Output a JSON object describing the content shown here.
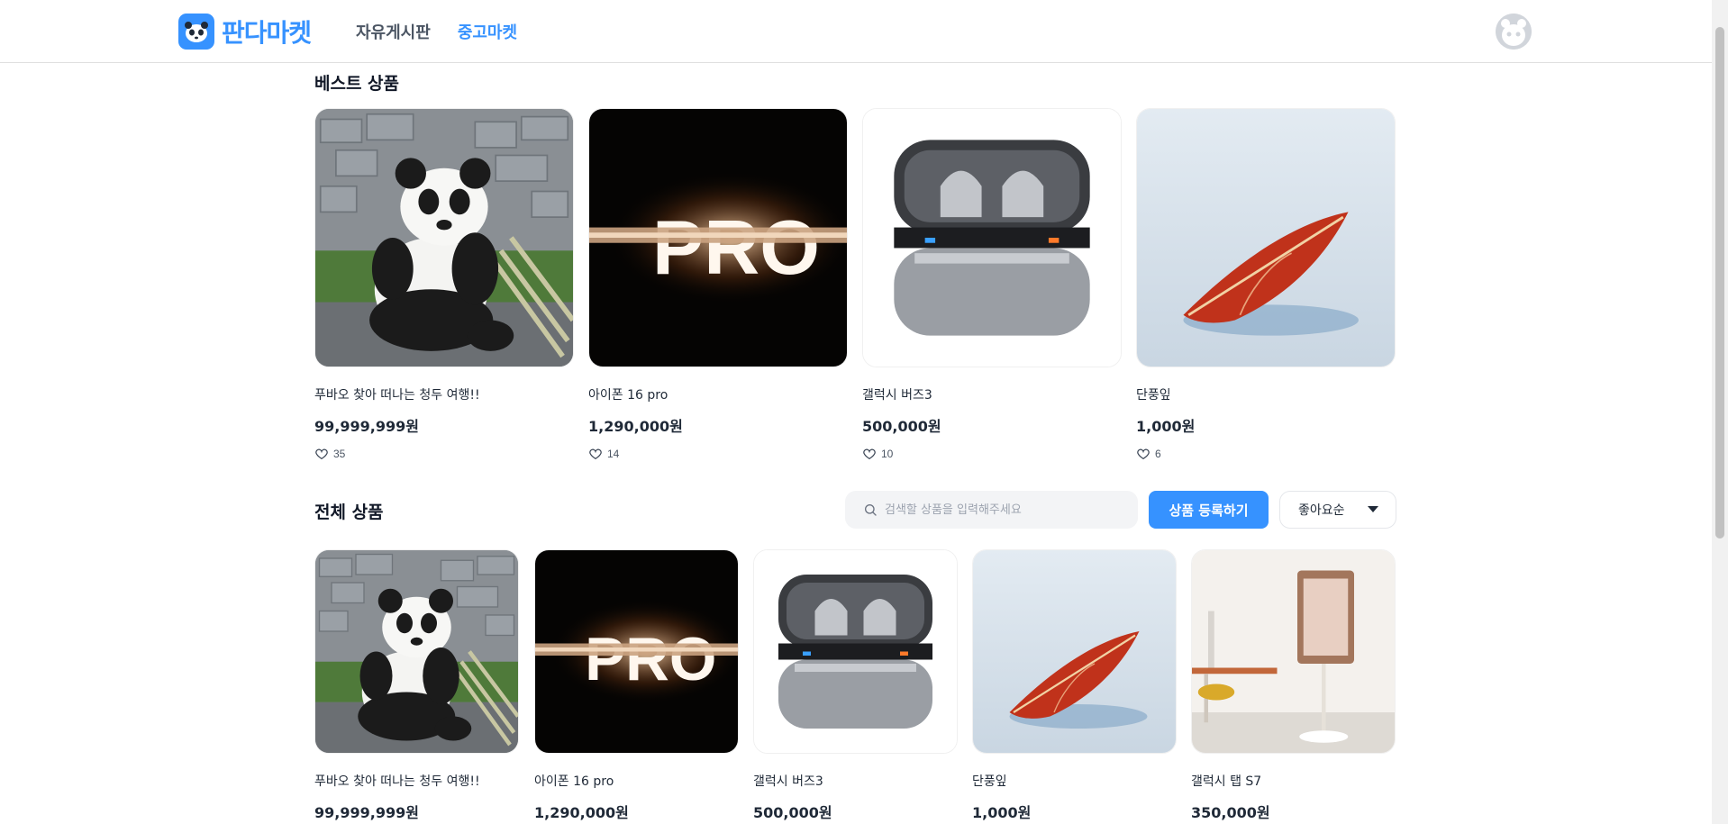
{
  "header": {
    "logo_text": "판다마켓",
    "nav": [
      "자유게시판",
      "중고마켓"
    ],
    "active_nav": "중고마켓"
  },
  "best": {
    "title": "베스트 상품",
    "items": [
      {
        "name": "푸바오 찾아 떠나는 청두 여행!!",
        "price": "99,999,999원",
        "likes": "35",
        "image": "panda"
      },
      {
        "name": "아이폰 16 pro",
        "price": "1,290,000원",
        "likes": "14",
        "image": "iphone-pro"
      },
      {
        "name": "갤럭시 버즈3",
        "price": "500,000원",
        "likes": "10",
        "image": "earbuds"
      },
      {
        "name": "단풍잎",
        "price": "1,000원",
        "likes": "6",
        "image": "maple-leaf"
      }
    ]
  },
  "all": {
    "title": "전체 상품",
    "search_placeholder": "검색할 상품을 입력해주세요",
    "register_label": "상품 등록하기",
    "sort_label": "좋아요순",
    "items": [
      {
        "name": "푸바오 찾아 떠나는 청두 여행!!",
        "price": "99,999,999원",
        "image": "panda"
      },
      {
        "name": "아이폰 16 pro",
        "price": "1,290,000원",
        "image": "iphone-pro"
      },
      {
        "name": "갤럭시 버즈3",
        "price": "500,000원",
        "image": "earbuds"
      },
      {
        "name": "단풍잎",
        "price": "1,000원",
        "image": "maple-leaf"
      },
      {
        "name": "갤럭시 탭 S7",
        "price": "350,000원",
        "image": "tablet-stand"
      }
    ]
  },
  "colors": {
    "brand": "#3692ff",
    "text": "#1f2937"
  }
}
